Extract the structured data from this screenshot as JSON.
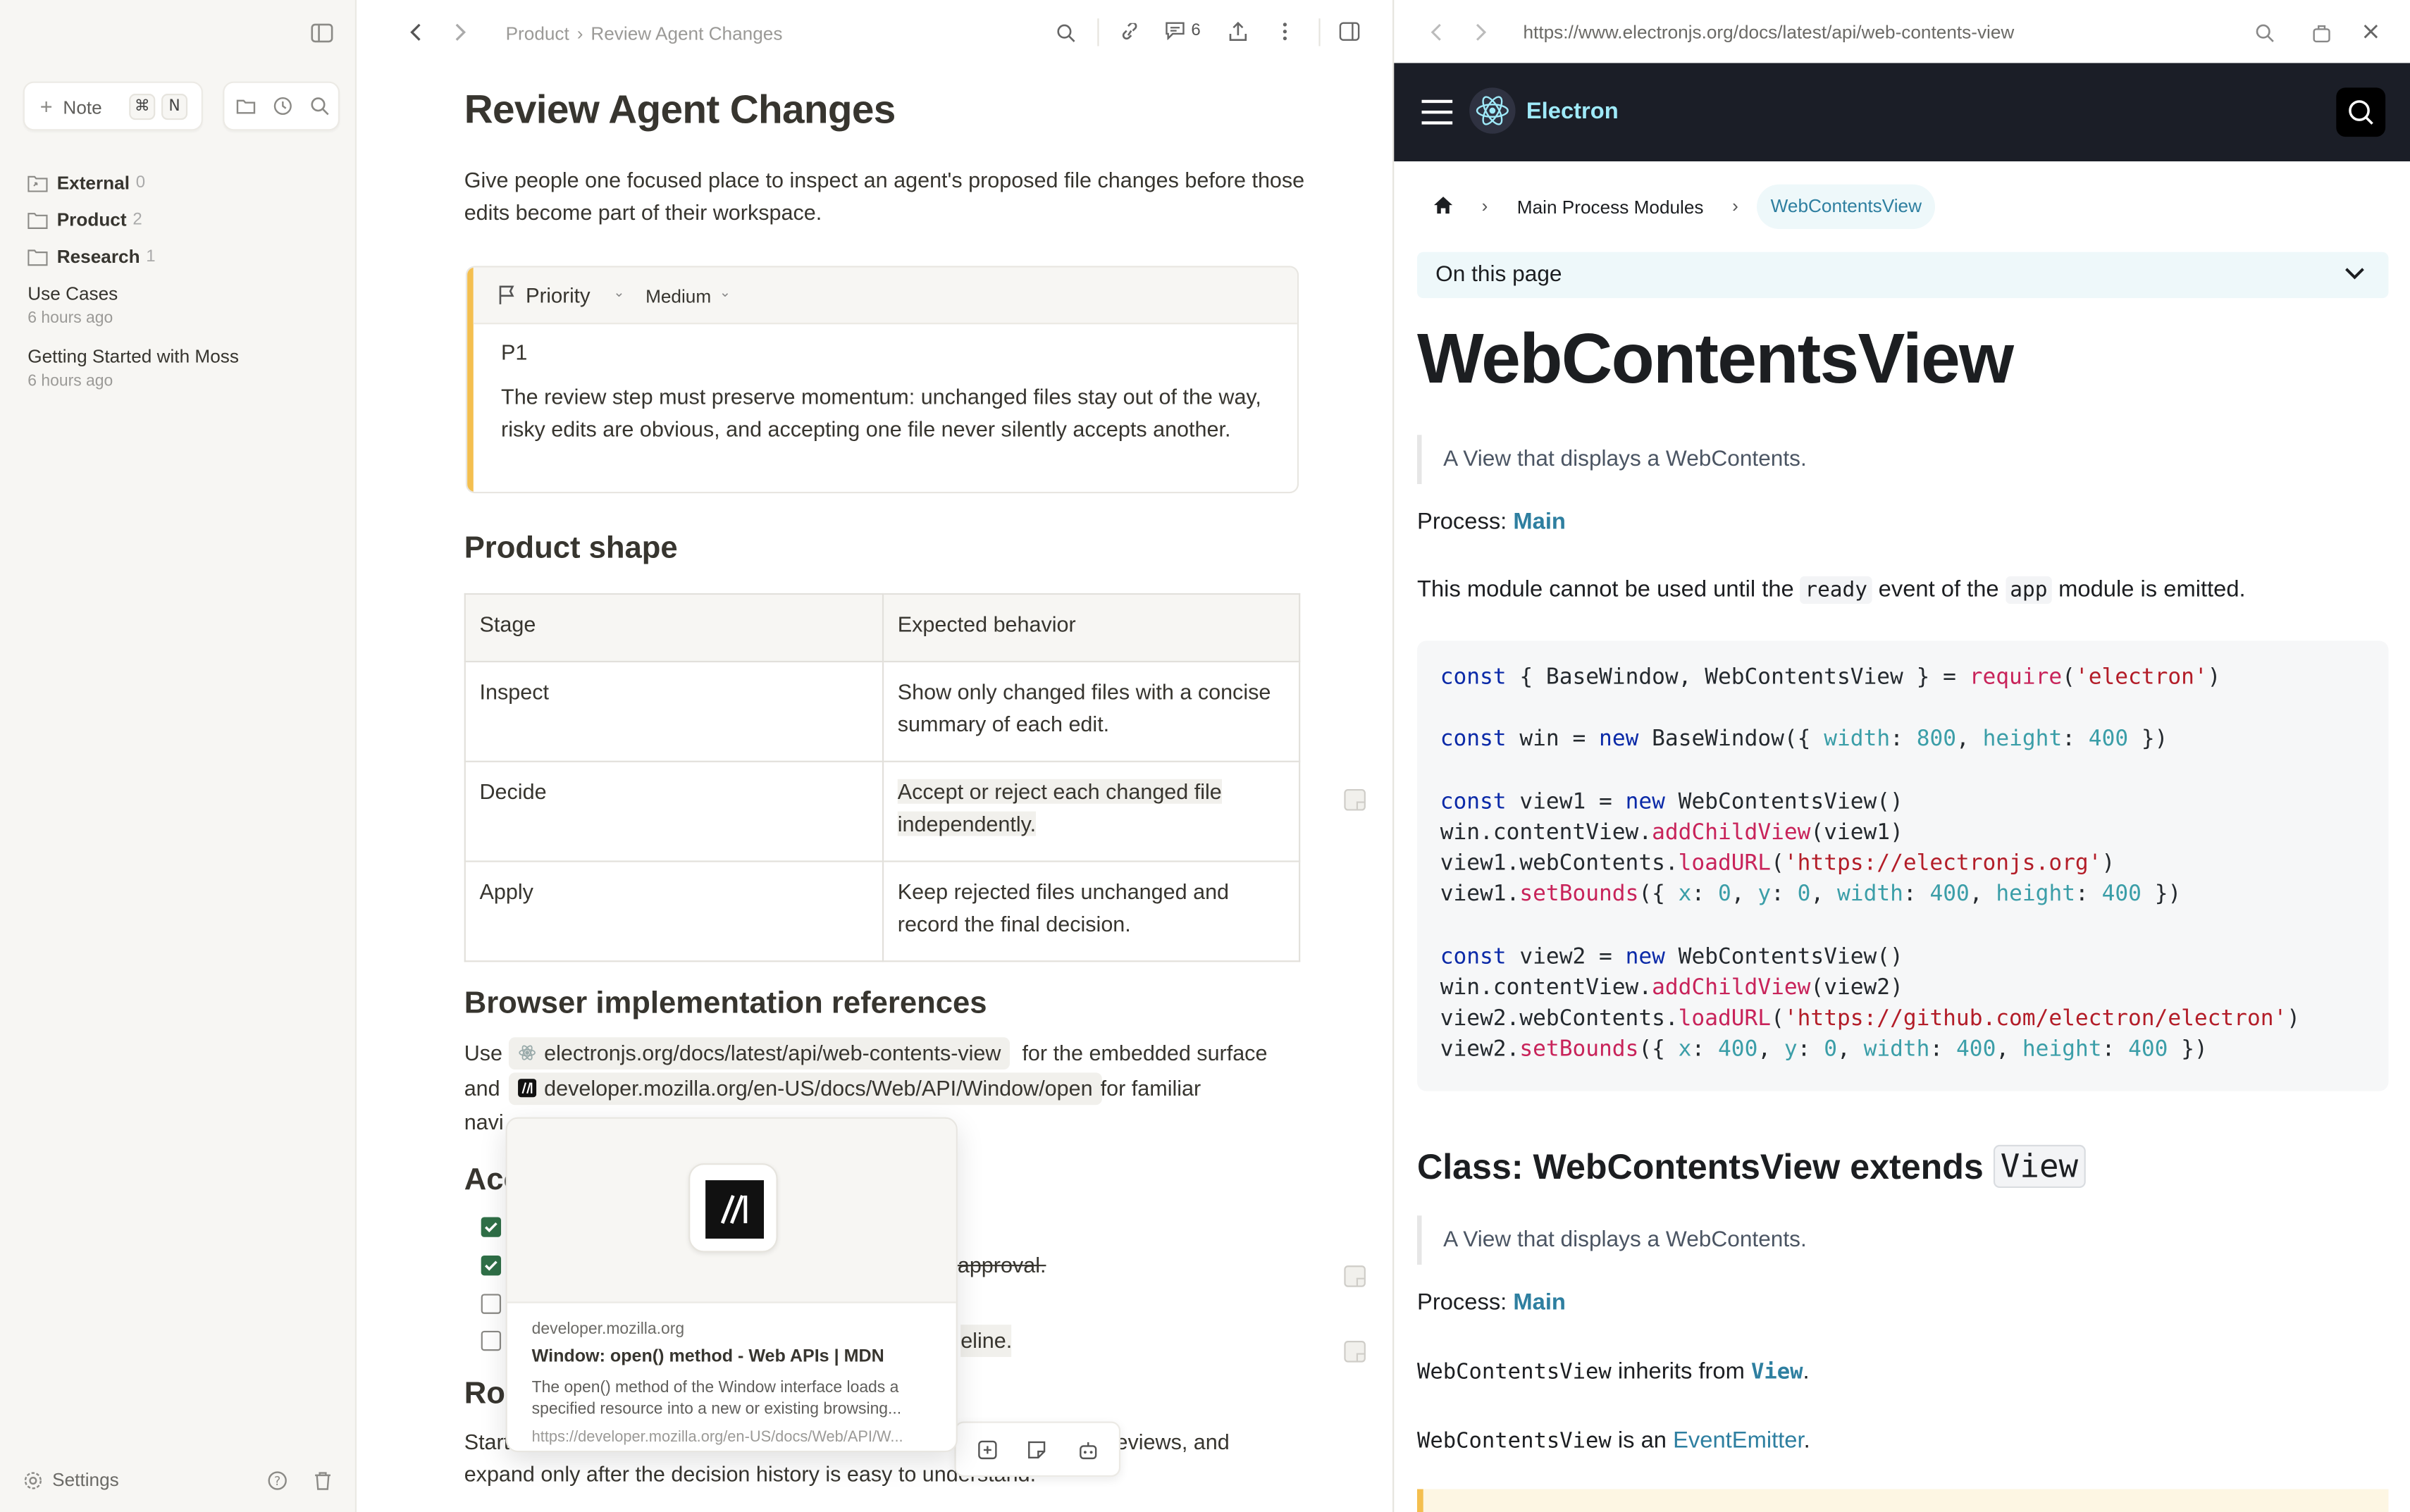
{
  "sidebar": {
    "new_note_label": "Note",
    "new_note_shortcut": [
      "⌘",
      "N"
    ],
    "folders": [
      {
        "label": "External",
        "count": "0"
      },
      {
        "label": "Product",
        "count": "2"
      },
      {
        "label": "Research",
        "count": "1"
      }
    ],
    "notes": [
      {
        "title": "Use Cases",
        "time": "6 hours ago"
      },
      {
        "title": "Getting Started with Moss",
        "time": "6 hours ago"
      }
    ],
    "settings_label": "Settings"
  },
  "editor": {
    "breadcrumb": [
      "Product",
      "Review Agent Changes"
    ],
    "comment_count": "6",
    "title": "Review Agent Changes",
    "intro": "Give people one focused place to inspect an agent's proposed file changes before those edits become part of their workspace.",
    "callout": {
      "property": "Priority",
      "value": "Medium",
      "level": "P1",
      "text": "The review step must preserve momentum: unchanged files stay out of the way, risky edits are obvious, and accepting one file never silently accepts another."
    },
    "product_shape_heading": "Product shape",
    "table": {
      "headers": [
        "Stage",
        "Expected behavior"
      ],
      "rows": [
        [
          "Inspect",
          "Show only changed files with a concise summary of each edit."
        ],
        [
          "Decide",
          "Accept or reject each changed file independently."
        ],
        [
          "Apply",
          "Keep rejected files unchanged and record the final decision."
        ]
      ]
    },
    "browser_refs_heading": "Browser implementation references",
    "refs": {
      "use": "Use",
      "electron_link": "electronjs.org/docs/latest/api/web-contents-view",
      "after_electron": "for the embedded surface",
      "and": "and",
      "mdn_link": "developer.mozilla.org/en-US/docs/Web/API/Window/open",
      "after_mdn": "for familiar",
      "line3": "navigation behavior."
    },
    "accept_heading_partial": "Acc",
    "checklist_visible": [
      "approval.",
      "eline."
    ],
    "role_heading_partial": "Rol",
    "last_para_start": "Start",
    "last_para_end": "eviews, and",
    "last_para_line2": "expand only after the decision history is easy to understand."
  },
  "link_preview": {
    "domain": "developer.mozilla.org",
    "title": "Window: open() method - Web APIs | MDN",
    "description": "The open() method of the Window interface loads a specified resource into a new or existing browsing...",
    "url": "https://developer.mozilla.org/en-US/docs/Web/API/W..."
  },
  "browser": {
    "url": "https://www.electronjs.org/docs/latest/api/web-contents-view",
    "brand": "Electron",
    "breadcrumb_mid": "Main Process Modules",
    "breadcrumb_active": "WebContentsView",
    "on_this_page": "On this page",
    "title": "WebContentsView",
    "blurb": "A View that displays a WebContents.",
    "process_label": "Process:",
    "process_link": "Main",
    "module_note_pre": "This module cannot be used until the",
    "module_note_code1": "ready",
    "module_note_mid": "event of the",
    "module_note_code2": "app",
    "module_note_post": "module is emitted.",
    "class_heading": "Class: WebContentsView extends",
    "class_heading_code": "View",
    "class_blurb": "A View that displays a WebContents.",
    "process_label2": "Process:",
    "process_link2": "Main",
    "inherits_code": "WebContentsView",
    "inherits_text": "inherits from",
    "inherits_link": "View",
    "emitter_code": "WebContentsView",
    "emitter_text": "is an",
    "emitter_link": "EventEmitter"
  },
  "colors": {
    "accent_yellow": "#f4bf4f",
    "electron_navbar": "#1b1e27",
    "link_blue": "#2e7fa0",
    "check_green": "#2f6f47"
  }
}
